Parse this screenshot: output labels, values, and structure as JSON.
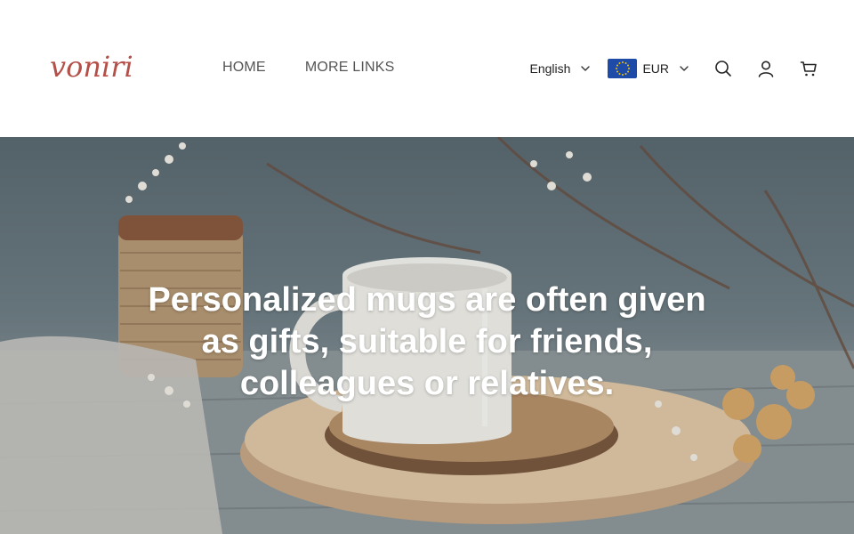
{
  "header": {
    "logo_text": "voniri",
    "nav": [
      {
        "label": "HOME"
      },
      {
        "label": "MORE LINKS"
      }
    ],
    "language": {
      "label": "English"
    },
    "currency": {
      "label": "EUR",
      "flag": "eu-flag"
    },
    "icons": [
      "search-icon",
      "account-icon",
      "cart-icon"
    ]
  },
  "hero": {
    "headline": "Personalized mugs are often given as gifts, suitable for friends, colleagues or relatives."
  },
  "colors": {
    "logo": "#b4504a",
    "nav_text": "#555555",
    "flag_blue": "#1e4aa8",
    "flag_stars": "#f5c400"
  }
}
